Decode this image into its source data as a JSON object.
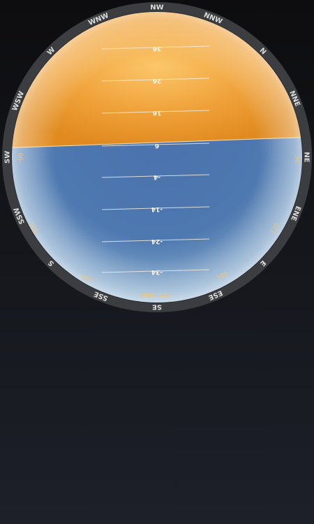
{
  "colors": {
    "sky": "#ec9a2a",
    "ground": "#4a72ad",
    "bezel": "#3b3d40",
    "compass_text": "#dcdcdc",
    "ring_numbers": "#f0c27a"
  },
  "compass": {
    "labels": [
      {
        "text": "NW"
      },
      {
        "text": "NNW"
      },
      {
        "text": "N"
      },
      {
        "text": "NNE"
      },
      {
        "text": "NE"
      },
      {
        "text": "ENE"
      },
      {
        "text": "E"
      },
      {
        "text": "ESE"
      },
      {
        "text": "SE"
      },
      {
        "text": "SSE"
      },
      {
        "text": "S"
      },
      {
        "text": "SSW"
      },
      {
        "text": "SW"
      },
      {
        "text": "WSW"
      },
      {
        "text": "W"
      },
      {
        "text": "WNW"
      }
    ]
  },
  "ring_numbers": [
    "06-",
    "150-",
    "-180",
    "150",
    "120",
    "90",
    "-90",
    "-120"
  ],
  "pitch_ladder": [
    {
      "label": "36"
    },
    {
      "label": "26"
    },
    {
      "label": "16"
    },
    {
      "label": "6"
    },
    {
      "label": "-4"
    },
    {
      "label": "-14"
    },
    {
      "label": "-24"
    },
    {
      "label": "-34"
    }
  ],
  "readout": "-177 SSW2"
}
